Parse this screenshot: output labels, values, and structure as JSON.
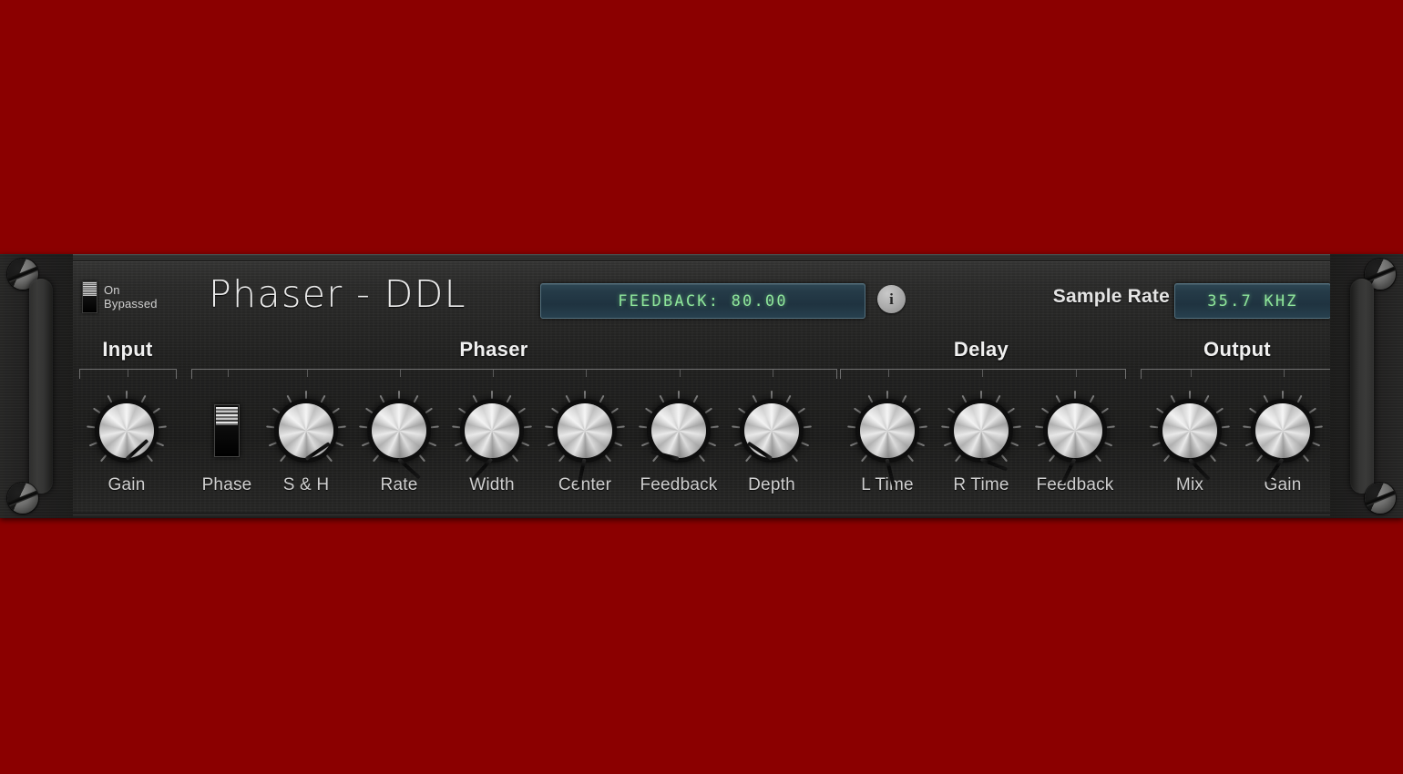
{
  "window": {
    "background_color": "#8b0000"
  },
  "header": {
    "bypass": {
      "on_label": "On",
      "bypassed_label": "Bypassed",
      "state": "Bypassed"
    },
    "plugin_title": "Phaser - DDL",
    "main_readout": "FEEDBACK: 80.00",
    "info_icon": "i",
    "sample_rate_label": "Sample Rate",
    "sample_rate_value": "35.7 KHZ",
    "lcd_text_color": "#8ee59a",
    "lcd_bg_color": "#253b48"
  },
  "sections": [
    {
      "name": "input",
      "title": "Input"
    },
    {
      "name": "phaser",
      "title": "Phaser"
    },
    {
      "name": "delay",
      "title": "Delay"
    },
    {
      "name": "output",
      "title": "Output"
    }
  ],
  "controls": [
    {
      "name": "input-gain",
      "label": "Gain",
      "type": "knob",
      "section": "input",
      "angle": -132
    },
    {
      "name": "phase",
      "label": "Phase",
      "type": "switch",
      "section": "phaser",
      "state": "down"
    },
    {
      "name": "sample-and-hold",
      "label": "S & H",
      "type": "knob",
      "section": "phaser",
      "angle": -124
    },
    {
      "name": "rate",
      "label": "Rate",
      "type": "knob",
      "section": "phaser",
      "angle": -48
    },
    {
      "name": "width",
      "label": "Width",
      "type": "knob",
      "section": "phaser",
      "angle": 42
    },
    {
      "name": "center",
      "label": "Center",
      "type": "knob",
      "section": "phaser",
      "angle": 12
    },
    {
      "name": "phaser-feedback",
      "label": "Feedback",
      "type": "knob",
      "section": "phaser",
      "angle": 104
    },
    {
      "name": "depth",
      "label": "Depth",
      "type": "knob",
      "section": "phaser",
      "angle": 124
    },
    {
      "name": "l-time",
      "label": "L Time",
      "type": "knob",
      "section": "delay",
      "angle": -14
    },
    {
      "name": "r-time",
      "label": "R Time",
      "type": "knob",
      "section": "delay",
      "angle": -68
    },
    {
      "name": "delay-feedback",
      "label": "Feedback",
      "type": "knob",
      "section": "delay",
      "angle": 26
    },
    {
      "name": "mix",
      "label": "Mix",
      "type": "knob",
      "section": "output",
      "angle": -44
    },
    {
      "name": "output-gain",
      "label": "Gain",
      "type": "knob",
      "section": "output",
      "angle": 34
    }
  ]
}
